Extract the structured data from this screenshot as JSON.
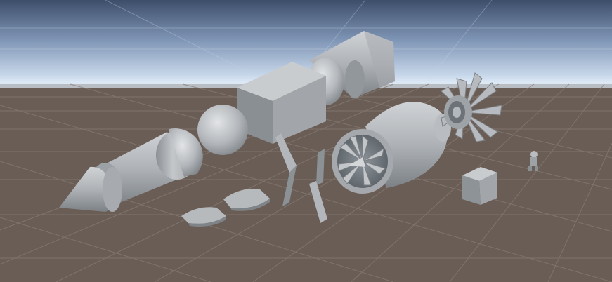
{
  "scene": {
    "view": "unity-scene-view-viewport",
    "colors": {
      "sky_top": "#3d4e6a",
      "sky_mid": "#9fb3cf",
      "horizon_glow": "#e6f1fb",
      "ground": "#6a5d55",
      "grid_line": "#8b8079",
      "mesh_light": "#c9cccf",
      "mesh_mid": "#a3a7ab",
      "mesh_dark": "#7d8287",
      "mesh_shadow": "#5e6368"
    },
    "objects": [
      {
        "name": "nose-cone",
        "icon": "cone-mesh"
      },
      {
        "name": "fuselage-cylinder",
        "icon": "cylinder-mesh"
      },
      {
        "name": "hemisphere-cap",
        "icon": "hemisphere-mesh"
      },
      {
        "name": "sphere",
        "icon": "sphere-mesh"
      },
      {
        "name": "cube-large",
        "icon": "cube-mesh"
      },
      {
        "name": "capsule-joint",
        "icon": "capsule-mesh"
      },
      {
        "name": "tapered-body",
        "icon": "frustum-mesh"
      },
      {
        "name": "wing-fin-left",
        "icon": "fin-mesh"
      },
      {
        "name": "wing-fin-right",
        "icon": "fin-mesh"
      },
      {
        "name": "airfoil-small-front",
        "icon": "airfoil-mesh"
      },
      {
        "name": "airfoil-small-back",
        "icon": "airfoil-mesh"
      },
      {
        "name": "jet-engine-nacelle",
        "icon": "turbofan-mesh"
      },
      {
        "name": "turbine-rotor",
        "icon": "turbine-mesh"
      },
      {
        "name": "cube-small",
        "icon": "cube-mesh"
      },
      {
        "name": "tiny-figure",
        "icon": "figure-mesh"
      }
    ]
  }
}
